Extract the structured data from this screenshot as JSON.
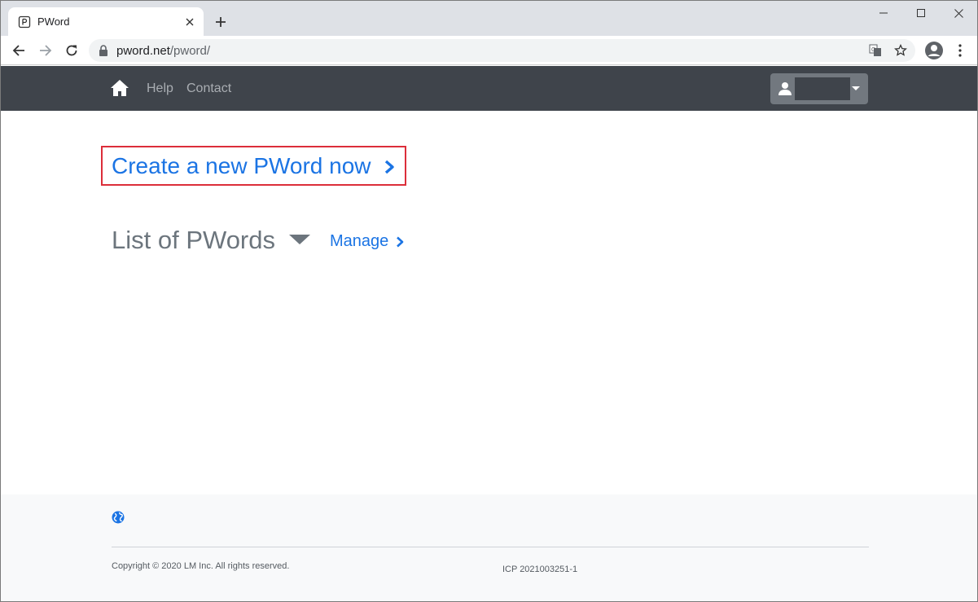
{
  "browser": {
    "tab_title": "PWord",
    "url_host": "pword.net",
    "url_path": "/pword/"
  },
  "navbar": {
    "links": [
      "Help",
      "Contact"
    ]
  },
  "main": {
    "create_label": "Create a new PWord now",
    "list_title": "List of PWords",
    "manage_label": "Manage"
  },
  "footer": {
    "copyright": "Copyright © 2020 LM Inc. All rights reserved.",
    "icp": "ICP 2021003251-1"
  },
  "colors": {
    "link": "#1b74e4",
    "navbar_bg": "#3f444b",
    "highlight_border": "#dc2e3a"
  }
}
